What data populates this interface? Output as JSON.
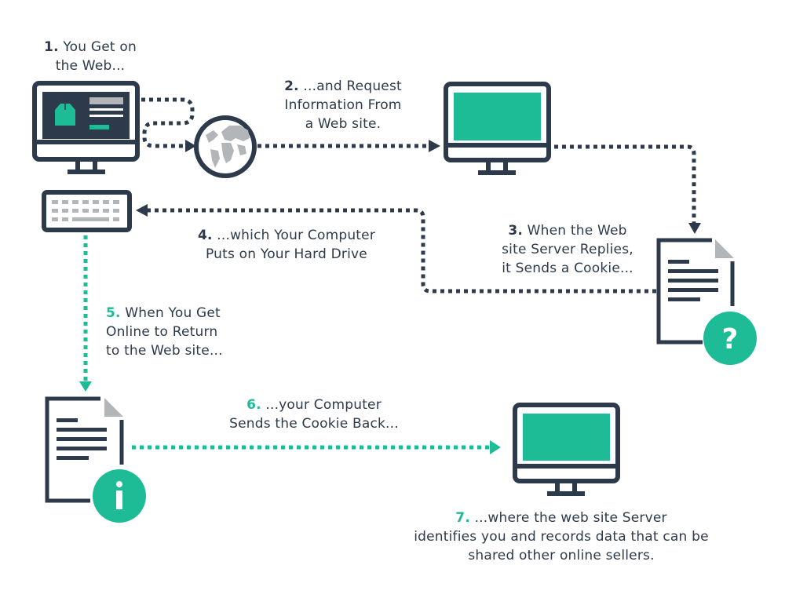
{
  "colors": {
    "dark": "#2c3a4b",
    "teal": "#1ebb97",
    "gray": "#b3b6b8",
    "white": "#ffffff"
  },
  "steps": [
    {
      "number": "1.",
      "lines": [
        "You Get on",
        "the Web..."
      ],
      "accent": "dark"
    },
    {
      "number": "2.",
      "lines": [
        "...and Request",
        "Information From",
        "a Web site."
      ],
      "accent": "dark"
    },
    {
      "number": "3.",
      "lines": [
        "When the Web",
        "site Server Replies,",
        "it Sends a Cookie..."
      ],
      "accent": "dark"
    },
    {
      "number": "4.",
      "lines": [
        "...which Your Computer",
        "Puts on Your Hard Drive"
      ],
      "accent": "dark"
    },
    {
      "number": "5.",
      "lines": [
        "When You Get",
        "Online to Return",
        "to the Web site..."
      ],
      "accent": "teal"
    },
    {
      "number": "6.",
      "lines": [
        "...your Computer",
        "Sends the Cookie Back..."
      ],
      "accent": "teal"
    },
    {
      "number": "7.",
      "lines": [
        "...where the web site Server",
        "identifies you and records data that can be",
        "shared other online sellers."
      ],
      "accent": "teal"
    }
  ],
  "icons": {
    "cookie_badge_question": "?",
    "cookie_badge_info": "i"
  }
}
